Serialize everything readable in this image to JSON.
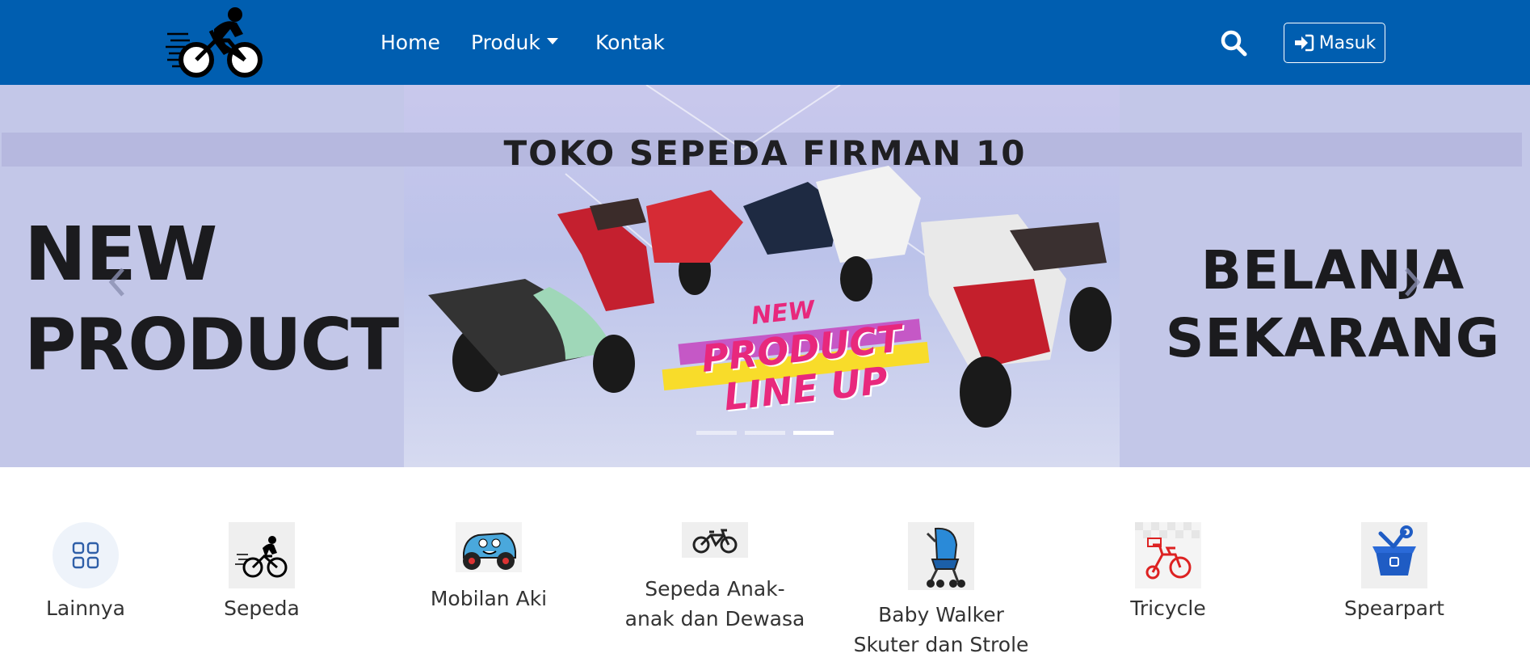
{
  "navbar": {
    "logo_icon": "cyclist-logo-icon",
    "links": [
      {
        "label": "Home"
      },
      {
        "label": "Produk",
        "has_dropdown": true
      },
      {
        "label": "Kontak"
      }
    ],
    "search_icon": "search-icon",
    "login_label": "Masuk",
    "login_icon": "sign-in-icon",
    "background_color": "#005eb0"
  },
  "carousel": {
    "banner_title": "TOKO SEPEDA FIRMAN 10",
    "left_text_line1": "NEW",
    "left_text_line2": "PRODUCT",
    "right_text_line1": "BELANJA",
    "right_text_line2": "SEKARANG",
    "promo_new": "NEW",
    "promo_line1": "PRODUCT",
    "promo_line2": "LINE UP",
    "active_slide": 3,
    "slide_count": 3
  },
  "categories": [
    {
      "label": "Lainnya",
      "icon": "grid-icon"
    },
    {
      "label": "Sepeda",
      "icon": "cyclist-icon"
    },
    {
      "label": "Mobilan Aki",
      "icon": "toy-car-icon"
    },
    {
      "label_line1": "Sepeda Anak-",
      "label_line2": "anak dan Dewasa",
      "icon": "bicycle-icon"
    },
    {
      "label_line1": "Baby Walker",
      "label_line2": "Skuter dan Strole",
      "icon": "stroller-icon"
    },
    {
      "label": "Tricycle",
      "icon": "tricycle-icon"
    },
    {
      "label": "Spearpart",
      "icon": "toolbox-icon"
    }
  ]
}
